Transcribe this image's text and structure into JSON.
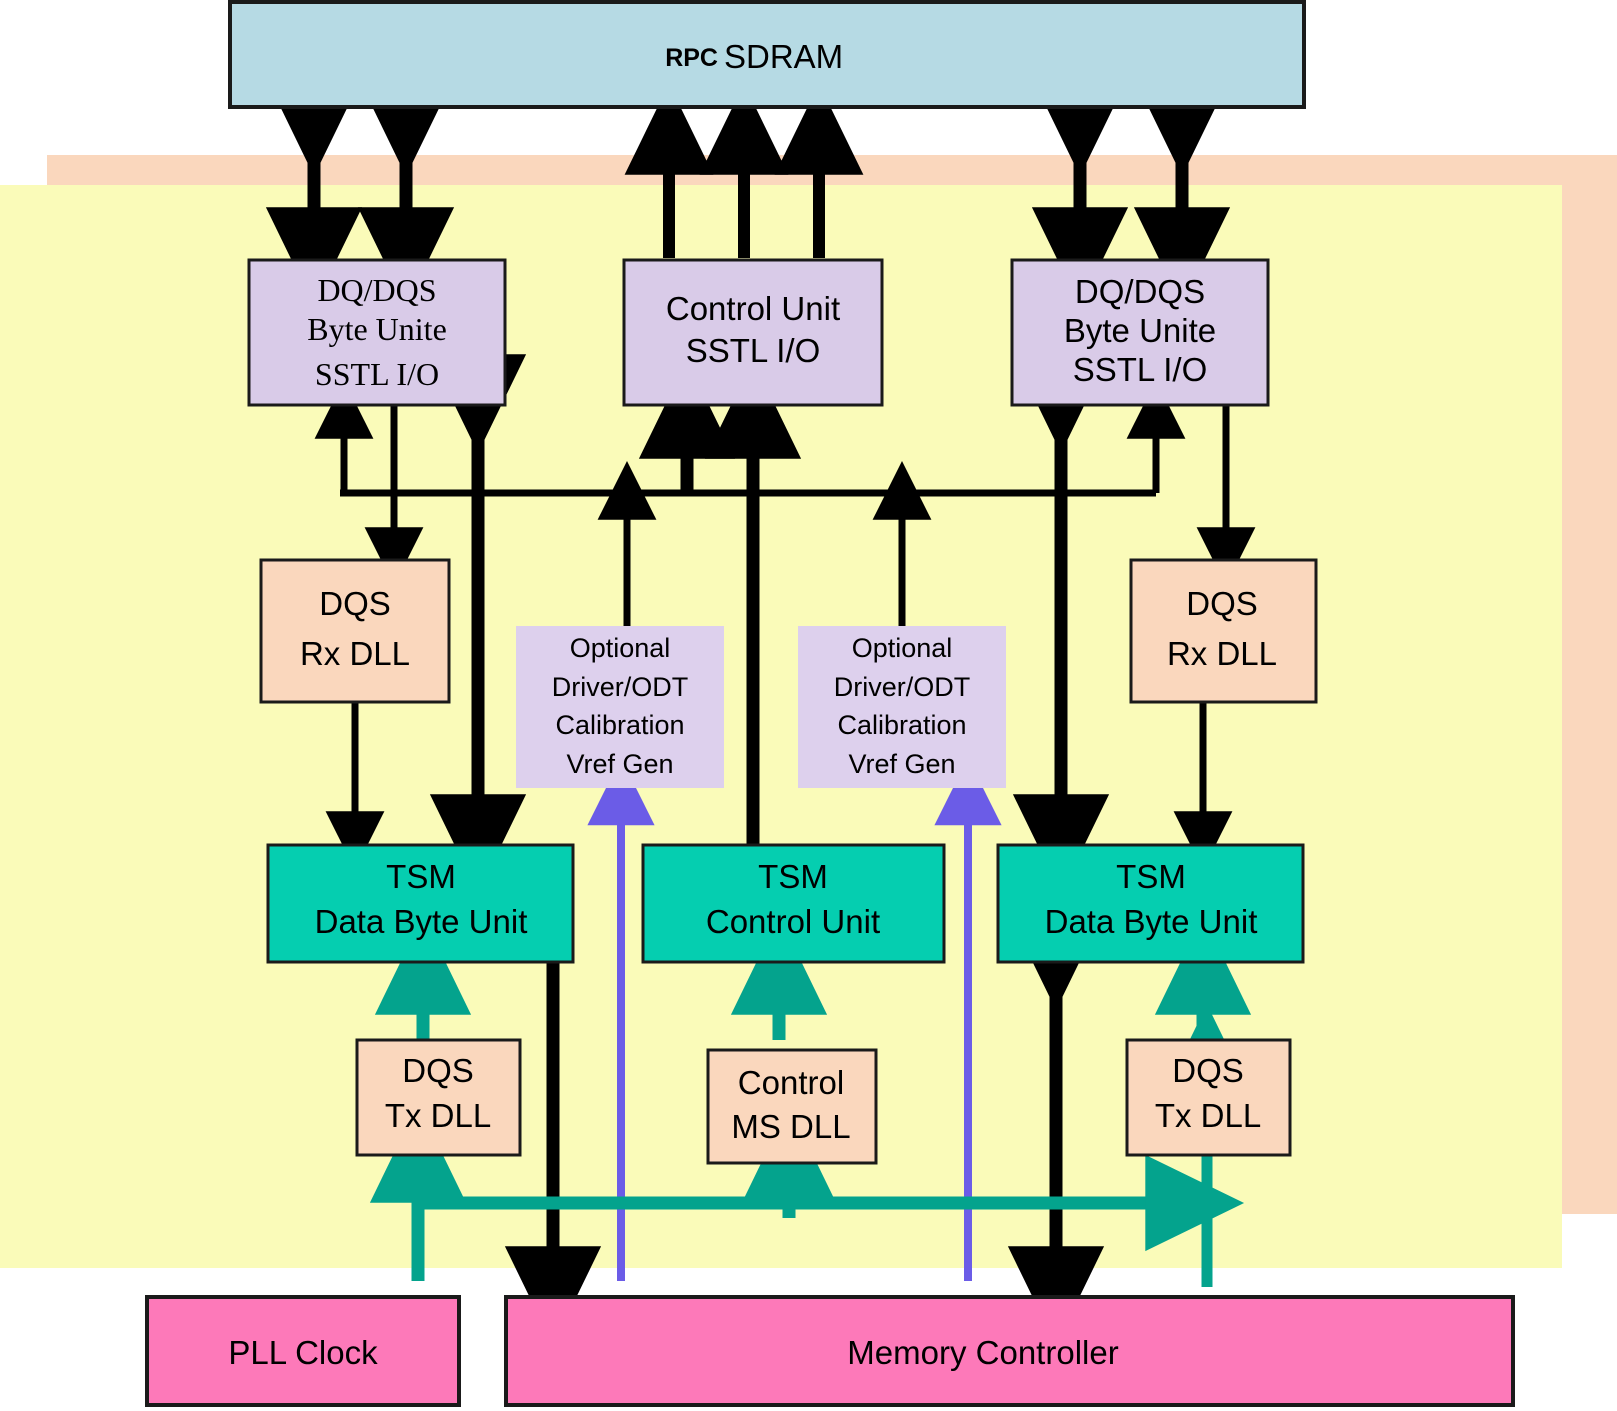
{
  "diagram": {
    "title_box": {
      "name": "rpc-sdram",
      "prefix": "RPC",
      "label": "SDRAM",
      "fill": "#b6dae4"
    },
    "panels": {
      "orange": {
        "name": "io-layer-panel",
        "fill": "#fad7bd"
      },
      "yellow": {
        "name": "phy-layer-panel",
        "fill": "#fafbb9"
      }
    },
    "io_blocks": [
      {
        "id": "dq-dqs-left",
        "lines": [
          "DQ/DQS",
          "Byte Unite",
          "SSTL I/O"
        ],
        "fill": "#d9cbe8",
        "serif": true
      },
      {
        "id": "control-unit-io",
        "lines": [
          "Control Unit",
          "SSTL I/O"
        ],
        "fill": "#d9cbe8",
        "serif": false
      },
      {
        "id": "dq-dqs-right",
        "lines": [
          "DQ/DQS",
          "Byte Unite",
          "SSTL I/O"
        ],
        "fill": "#d9cbe8",
        "serif": false
      }
    ],
    "dll_rx_blocks": [
      {
        "id": "dqs-rx-dll-left",
        "lines": [
          "DQS",
          "Rx DLL"
        ],
        "fill": "#fad7bd"
      },
      {
        "id": "dqs-rx-dll-right",
        "lines": [
          "DQS",
          "Rx DLL"
        ],
        "fill": "#fad7bd"
      }
    ],
    "optional_blocks": [
      {
        "id": "optional-calibration-left",
        "lines": [
          "Optional",
          "Driver/ODT",
          "Calibration",
          "Vref Gen"
        ],
        "fill": "#ddd0ed"
      },
      {
        "id": "optional-calibration-right",
        "lines": [
          "Optional",
          "Driver/ODT",
          "Calibration",
          "Vref Gen"
        ],
        "fill": "#ddd0ed"
      }
    ],
    "tsm_blocks": [
      {
        "id": "tsm-data-byte-unit-left",
        "lines": [
          "TSM",
          "Data Byte Unit"
        ],
        "fill": "#05ceb0"
      },
      {
        "id": "tsm-control-unit",
        "lines": [
          "TSM",
          "Control Unit"
        ],
        "fill": "#05ceb0"
      },
      {
        "id": "tsm-data-byte-unit-right",
        "lines": [
          "TSM",
          "Data Byte Unit"
        ],
        "fill": "#05ceb0"
      }
    ],
    "dll_tx_blocks": [
      {
        "id": "dqs-tx-dll-left",
        "lines": [
          "DQS",
          "Tx DLL"
        ],
        "fill": "#fad7bd"
      },
      {
        "id": "control-ms-dll",
        "lines": [
          "Control",
          "MS DLL"
        ],
        "fill": "#fad7bd"
      },
      {
        "id": "dqs-tx-dll-right",
        "lines": [
          "DQS",
          "Tx DLL"
        ],
        "fill": "#fad7bd"
      }
    ],
    "bottom_blocks": [
      {
        "id": "pll-clock",
        "label": "PLL Clock",
        "fill": "#fd79b9"
      },
      {
        "id": "memory-controller",
        "label": "Memory Controller",
        "fill": "#fd79b9"
      }
    ],
    "colors": {
      "wire_black": "#000000",
      "wire_teal": "#04a38d",
      "wire_purple": "#6b5ce7",
      "box_stroke": "#1a1a1a"
    }
  }
}
